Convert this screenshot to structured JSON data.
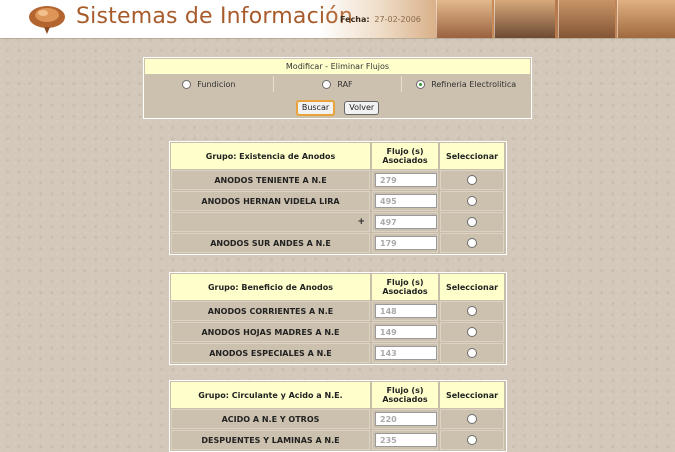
{
  "header": {
    "title": "Sistemas de Información",
    "fecha_label": "Fecha:",
    "fecha_value": "27-02-2006"
  },
  "panel": {
    "title": "Modificar - Eliminar Flujos",
    "options": [
      {
        "label": "Fundicion",
        "checked": false
      },
      {
        "label": "RAF",
        "checked": false
      },
      {
        "label": "Refineria Electrolitica",
        "checked": true
      }
    ],
    "buttons": {
      "buscar": "Buscar",
      "volver": "Volver"
    }
  },
  "table_headers": {
    "flujo": "Flujo (s) Asociados",
    "seleccionar": "Seleccionar"
  },
  "groups": [
    {
      "title": "Grupo: Existencia de Anodos",
      "rows": [
        {
          "name": "ANODOS TENIENTE A N.E",
          "flujo": "279"
        },
        {
          "name": "ANODOS HERNAN VIDELA LIRA",
          "flujo": "495"
        },
        {
          "name": "",
          "plus": "+",
          "flujo": "497"
        },
        {
          "name": "ANODOS SUR ANDES A N.E",
          "flujo": "179"
        }
      ]
    },
    {
      "title": "Grupo: Beneficio de Anodos",
      "rows": [
        {
          "name": "ANODOS CORRIENTES A N.E",
          "flujo": "148"
        },
        {
          "name": "ANODOS HOJAS MADRES A N.E",
          "flujo": "149"
        },
        {
          "name": "ANODOS ESPECIALES A N.E",
          "flujo": "143"
        }
      ]
    },
    {
      "title": "Grupo: Circulante y Acido a N.E.",
      "rows": [
        {
          "name": "ACIDO A N.E Y OTROS",
          "flujo": "220"
        },
        {
          "name": "DESPUENTES Y LAMINAS A N.E",
          "flujo": "235"
        }
      ]
    }
  ]
}
